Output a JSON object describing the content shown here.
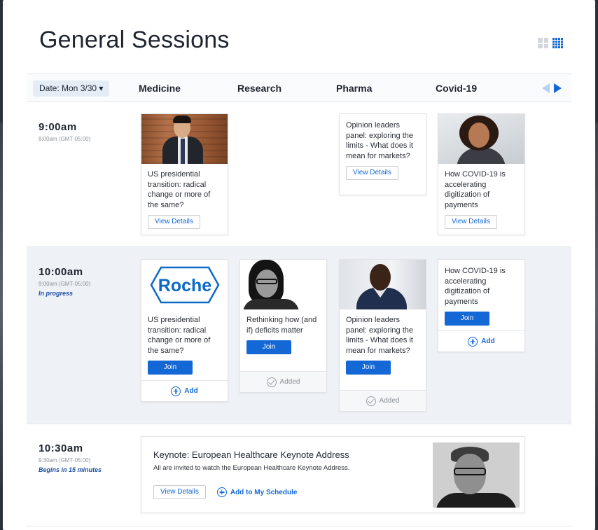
{
  "page": {
    "title": "General Sessions",
    "view_toggle": {
      "icons": [
        "grid-view-icon",
        "compact-grid-view-icon"
      ],
      "active": "compact-grid-view-icon"
    }
  },
  "header": {
    "date_label": "Date: Mon 3/30 ▾",
    "columns": [
      "Medicine",
      "Research",
      "Pharma",
      "Covid-19"
    ],
    "nav_icons": [
      "prev-arrow-icon",
      "next-arrow-icon"
    ]
  },
  "colors": {
    "accent": "#1468d6",
    "alt_row": "#eef1f5",
    "status": "#1f4fa0"
  },
  "rows": [
    {
      "time": "9:00am",
      "local_time": "8:00am (GMT-05:00)",
      "status": "",
      "sessions": [
        {
          "column": "Medicine",
          "image": "man-in-suit-photo",
          "title": "US presidential transition: radical change or more of the same?",
          "button": "View Details"
        },
        {
          "column": "Pharma",
          "image": "",
          "title": "Opinion leaders panel: exploring the limits - What does it mean for markets?",
          "button": "View Details"
        },
        {
          "column": "Covid-19",
          "image": "smiling-woman-photo",
          "title": "How COVID-19 is accelerating digitization of payments",
          "button": "View Details"
        }
      ]
    },
    {
      "time": "10:00am",
      "local_time": "9:00am (GMT-05:00)",
      "status": "In progress",
      "sessions": [
        {
          "column": "Medicine",
          "image": "roche-logo",
          "logo_text": "Roche",
          "title": "US presidential transition: radical change or more of the same?",
          "button": "Join",
          "footer": "Add"
        },
        {
          "column": "Research",
          "image": "woman-with-glasses-photo",
          "title": "Rethinking how (and if) deficits matter",
          "button": "Join",
          "footer": "Added"
        },
        {
          "column": "Pharma",
          "image": "man-in-navy-jacket-photo",
          "title": "Opinion leaders panel: exploring the limits - What does it mean for markets?",
          "button": "Join",
          "footer": "Added"
        },
        {
          "column": "Covid-19",
          "image": "",
          "title": "How COVID-19 is accelerating digitization of payments",
          "button": "Join",
          "footer": "Add"
        }
      ]
    },
    {
      "time": "10:30am",
      "local_time": "9:30am (GMT-05:00)",
      "status": "Begins in 15 minutes",
      "keynote": {
        "title": "Keynote: European Healthcare Keynote Address",
        "description": "All are invited to watch the European Healthcare Keynote Address.",
        "button": "View Details",
        "add_link": "Add to My Schedule",
        "image": "man-with-glasses-bw-photo"
      }
    }
  ]
}
